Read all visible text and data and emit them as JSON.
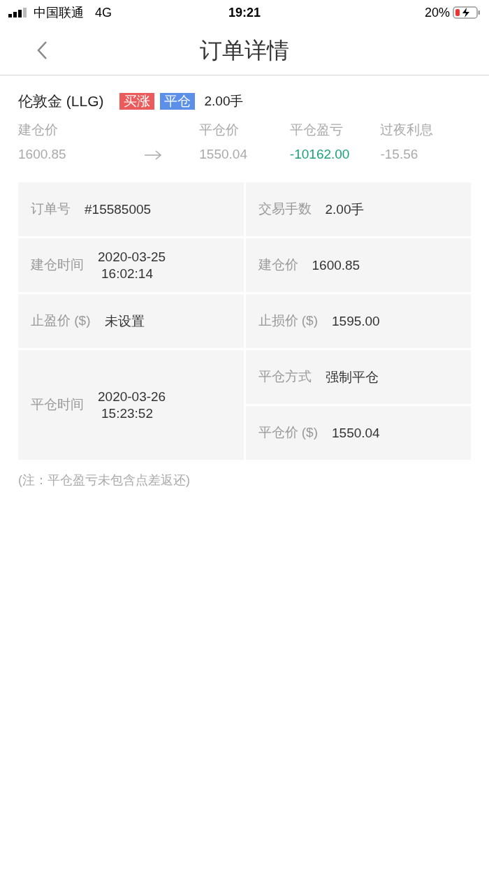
{
  "status_bar": {
    "carrier": "中国联通",
    "network": "4G",
    "time": "19:21",
    "battery": "20%"
  },
  "nav": {
    "title": "订单详情"
  },
  "summary": {
    "name": "伦敦金 (LLG)",
    "tags": [
      {
        "text": "买涨",
        "color": "#ec5b5b"
      },
      {
        "text": "平仓",
        "color": "#5b8fe8"
      }
    ],
    "lots": "2.00手",
    "stats": [
      {
        "label": "建仓价",
        "value": "1600.85",
        "kind": "normal"
      },
      {
        "label": "平仓价",
        "value": "1550.04",
        "kind": "normal"
      },
      {
        "label": "平仓盈亏",
        "value": "-10162.00",
        "kind": "profit"
      },
      {
        "label": "过夜利息",
        "value": "-15.56",
        "kind": "normal"
      }
    ]
  },
  "table": {
    "rows": [
      {
        "left": {
          "label": "订单号",
          "value": [
            "#15585005"
          ]
        },
        "right": [
          {
            "label": "交易手数",
            "value": [
              "2.00手"
            ]
          }
        ]
      },
      {
        "left": {
          "label": "建仓时间",
          "value": [
            "2020-03-25",
            "16:02:14"
          ]
        },
        "right": [
          {
            "label": "建仓价",
            "value": [
              "1600.85"
            ]
          }
        ]
      },
      {
        "left": {
          "label": "止盈价 ($)",
          "value": [
            "未设置"
          ]
        },
        "right": [
          {
            "label": "止损价 ($)",
            "value": [
              "1595.00"
            ]
          }
        ]
      },
      {
        "left": {
          "label": "平仓时间",
          "value": [
            "2020-03-26",
            "15:23:52"
          ]
        },
        "right": [
          {
            "label": "平仓方式",
            "value": [
              "强制平仓"
            ]
          },
          {
            "label": "平仓价 ($)",
            "value": [
              "1550.04"
            ]
          }
        ]
      }
    ]
  },
  "note": "(注：平仓盈亏未包含点差返还)"
}
